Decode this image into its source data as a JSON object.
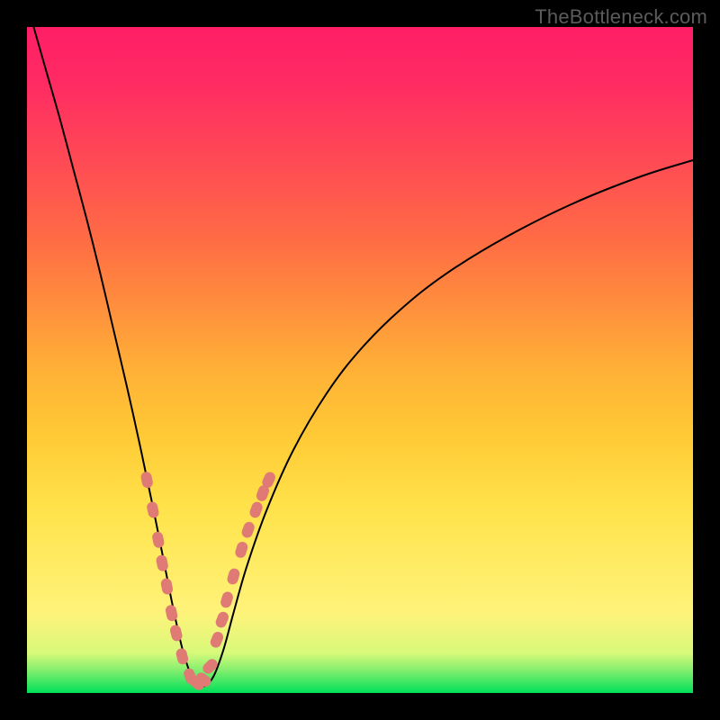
{
  "watermark": "TheBottleneck.com",
  "colors": {
    "frame": "#000000",
    "curve": "#000000",
    "marker": "#df7a74",
    "gradient_top": "#ff1e66",
    "gradient_bottom": "#00e05a"
  },
  "chart_data": {
    "type": "line",
    "title": "",
    "xlabel": "",
    "ylabel": "",
    "xlim": [
      0,
      100
    ],
    "ylim": [
      0,
      100
    ],
    "curve_description": "Asymmetric V-shaped bottleneck curve: steep left wall, minimum near x≈25, rising convex right tail toward upper right.",
    "curve_samples": {
      "x": [
        1.0,
        3.0,
        5.0,
        7.0,
        9.0,
        11.0,
        13.0,
        15.0,
        17.0,
        19.0,
        20.5,
        22.0,
        23.5,
        25.0,
        26.5,
        28.0,
        29.5,
        31.0,
        33.0,
        36.0,
        40.0,
        45.0,
        50.0,
        56.0,
        63.0,
        72.0,
        82.0,
        92.0,
        100.0
      ],
      "y": [
        100.0,
        93.0,
        86.0,
        78.5,
        71.0,
        63.0,
        54.5,
        46.0,
        37.0,
        27.5,
        20.0,
        12.5,
        6.0,
        2.0,
        1.0,
        2.5,
        6.5,
        12.0,
        19.0,
        27.5,
        36.5,
        45.0,
        51.5,
        57.5,
        63.0,
        68.5,
        73.5,
        77.5,
        80.0
      ]
    },
    "series": [
      {
        "name": "markers_left",
        "x": [
          18.0,
          18.9,
          19.7,
          20.3,
          21.0,
          21.7,
          22.4,
          23.3,
          24.5,
          25.5,
          26.5
        ],
        "y": [
          32.0,
          27.5,
          23.0,
          19.5,
          16.0,
          12.0,
          9.0,
          5.5,
          2.5,
          1.5,
          2.0
        ]
      },
      {
        "name": "markers_right",
        "x": [
          27.5,
          28.5,
          29.3,
          30.0,
          31.0,
          32.2,
          33.2,
          34.4,
          35.4,
          36.3
        ],
        "y": [
          4.0,
          8.0,
          11.0,
          14.0,
          17.5,
          21.5,
          24.5,
          27.5,
          30.0,
          32.0
        ]
      }
    ]
  }
}
